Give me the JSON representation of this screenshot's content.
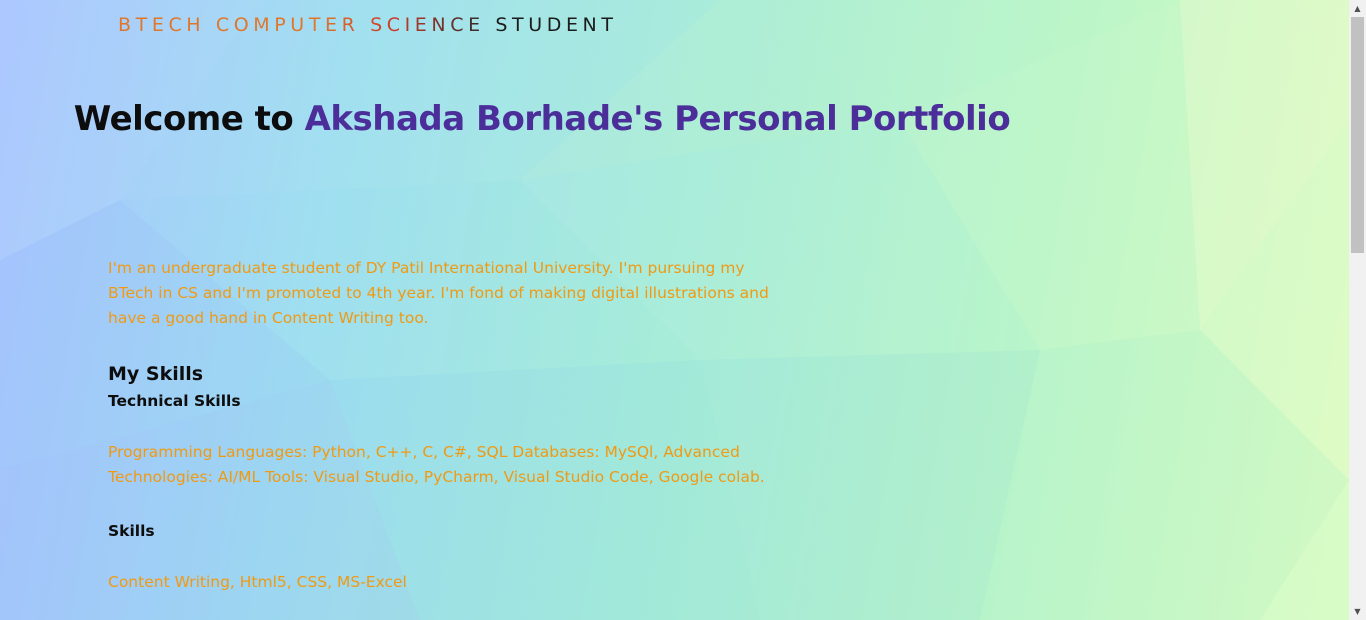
{
  "header": {
    "subtitle_colored": "BTECH COMPUTER SCIENCE",
    "subtitle_dark": "STUDENT"
  },
  "hero": {
    "title_prefix": "Welcome to",
    "title_name": "Akshada Borhade's Personal Portfolio"
  },
  "intro": {
    "text": "I'm an undergraduate student of DY Patil International University. I'm pursuing my BTech in CS and I'm promoted to 4th year. I'm fond of making digital illustrations and have a good hand in Content Writing too."
  },
  "skills": {
    "heading": "My Skills",
    "technical": {
      "heading": "Technical Skills",
      "text": "Programming Languages: Python, C++, C, C#, SQL Databases: MySQl, Advanced Technologies: AI/ML Tools: Visual Studio, PyCharm, Visual Studio Code, Google colab."
    },
    "other": {
      "heading": "Skills",
      "text": "Content Writing, Html5, CSS, MS-Excel"
    }
  },
  "scrollbar": {
    "position_fraction": 0.0
  },
  "colors": {
    "accent_orange": "#f09a14",
    "accent_purple": "#4b2e9a",
    "heading_dark": "#0d0d0d"
  },
  "icons": {
    "scroll_up": "triangle-up-icon",
    "scroll_down": "triangle-down-icon"
  }
}
